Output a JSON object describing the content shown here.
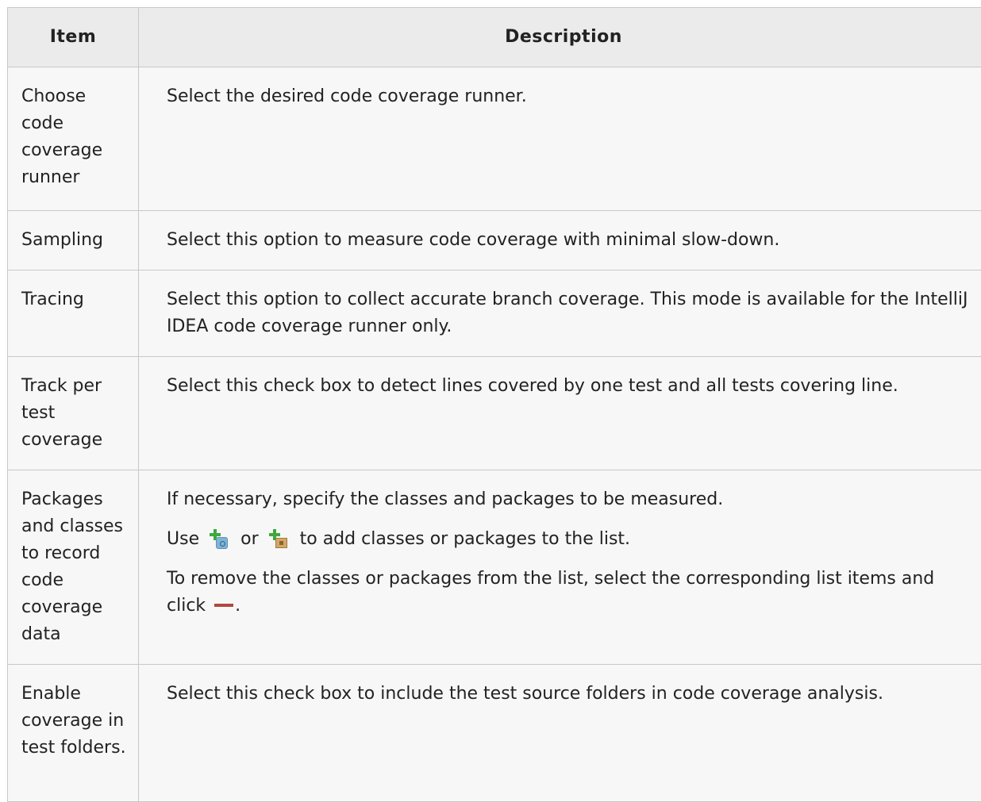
{
  "header": {
    "item": "Item",
    "description": "Description"
  },
  "rows": [
    {
      "item": "Choose code coverage runner",
      "description": "Select the desired code coverage runner."
    },
    {
      "item": "Sampling",
      "description": "Select this option to measure code coverage with minimal slow-down."
    },
    {
      "item": "Tracing",
      "description": "Select this option to collect accurate branch coverage. This mode is available for the IntelliJ IDEA code coverage runner only."
    },
    {
      "item": "Track per test coverage",
      "description": "Select this check box to detect lines covered by one test and all tests covering line."
    },
    {
      "item": "Packages and classes to record code coverage data",
      "p1": "If necessary, specify the classes and packages to be measured.",
      "p2_use": "Use",
      "p2_or": "or",
      "p2_rest": "to add classes or packages to the list.",
      "p3_text": "To remove the classes or packages from the list, select the corresponding list items and click",
      "p3_end": ".",
      "icons": [
        "add-class-icon",
        "add-package-icon",
        "remove-icon"
      ]
    },
    {
      "item": "Enable coverage in test folders.",
      "description": "Select this check box to include the test source folders in code coverage analysis."
    }
  ],
  "colors": {
    "header_bg": "#ebebeb",
    "cell_bg": "#f7f7f7",
    "border": "#c8c8c8",
    "plus": "#3ea83e",
    "remove": "#b14a3d"
  }
}
